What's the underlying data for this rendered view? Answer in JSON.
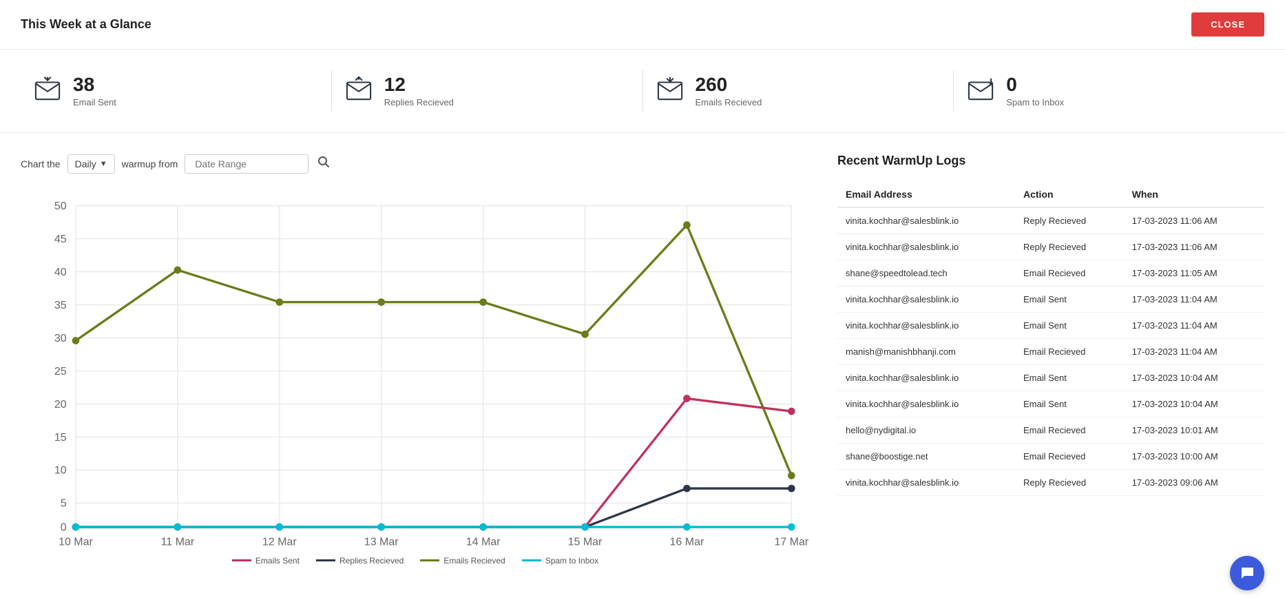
{
  "header": {
    "title": "This Week at a Glance",
    "close_label": "CLOSE"
  },
  "stats": [
    {
      "id": "emails-sent",
      "value": "38",
      "label": "Email Sent",
      "icon": "email-sent"
    },
    {
      "id": "replies-received",
      "value": "12",
      "label": "Replies Recieved",
      "icon": "email-reply"
    },
    {
      "id": "emails-received",
      "value": "260",
      "label": "Emails Recieved",
      "icon": "email-inbox"
    },
    {
      "id": "spam-to-inbox",
      "value": "0",
      "label": "Spam to Inbox",
      "icon": "email-spam"
    }
  ],
  "chart": {
    "label_before": "Chart the",
    "select_value": "Daily",
    "label_after": "warmup from",
    "date_placeholder": "Date Range",
    "y_labels": [
      "50",
      "45",
      "40",
      "35",
      "30",
      "25",
      "20",
      "15",
      "10",
      "5",
      "0"
    ],
    "x_labels": [
      "10 Mar",
      "11 Mar",
      "12 Mar",
      "13 Mar",
      "14 Mar",
      "15 Mar",
      "16 Mar",
      "17 Mar"
    ],
    "legend": [
      {
        "label": "Emails Sent",
        "color": "#c0325c"
      },
      {
        "label": "Replies Recieved",
        "color": "#2d3748"
      },
      {
        "label": "Emails Recieved",
        "color": "#6b7c1a"
      },
      {
        "label": "Spam to Inbox",
        "color": "#00bcd4"
      }
    ],
    "series": {
      "emails_sent": [
        0,
        0,
        0,
        0,
        0,
        0,
        20,
        18
      ],
      "replies_received": [
        0,
        0,
        0,
        0,
        0,
        0,
        6,
        6
      ],
      "emails_received": [
        29,
        40,
        35,
        35,
        35,
        30,
        47,
        8
      ],
      "spam_to_inbox": [
        0,
        0,
        0,
        0,
        0,
        0,
        0,
        0
      ]
    }
  },
  "logs": {
    "title": "Recent WarmUp Logs",
    "columns": [
      "Email Address",
      "Action",
      "When"
    ],
    "rows": [
      {
        "email": "vinita.kochhar@salesblink.io",
        "action": "Reply Recieved",
        "when": "17-03-2023 11:06 AM"
      },
      {
        "email": "vinita.kochhar@salesblink.io",
        "action": "Reply Recieved",
        "when": "17-03-2023 11:06 AM"
      },
      {
        "email": "shane@speedtolead.tech",
        "action": "Email Recieved",
        "when": "17-03-2023 11:05 AM"
      },
      {
        "email": "vinita.kochhar@salesblink.io",
        "action": "Email Sent",
        "when": "17-03-2023 11:04 AM"
      },
      {
        "email": "vinita.kochhar@salesblink.io",
        "action": "Email Sent",
        "when": "17-03-2023 11:04 AM"
      },
      {
        "email": "manish@manishbhanji.com",
        "action": "Email Recieved",
        "when": "17-03-2023 11:04 AM"
      },
      {
        "email": "vinita.kochhar@salesblink.io",
        "action": "Email Sent",
        "when": "17-03-2023 10:04 AM"
      },
      {
        "email": "vinita.kochhar@salesblink.io",
        "action": "Email Sent",
        "when": "17-03-2023 10:04 AM"
      },
      {
        "email": "hello@nydigital.io",
        "action": "Email Recieved",
        "when": "17-03-2023 10:01 AM"
      },
      {
        "email": "shane@boostige.net",
        "action": "Email Recieved",
        "when": "17-03-2023 10:00 AM"
      },
      {
        "email": "vinita.kochhar@salesblink.io",
        "action": "Reply Recieved",
        "when": "17-03-2023 09:06 AM"
      }
    ]
  },
  "chat_button": {
    "label": "💬"
  }
}
